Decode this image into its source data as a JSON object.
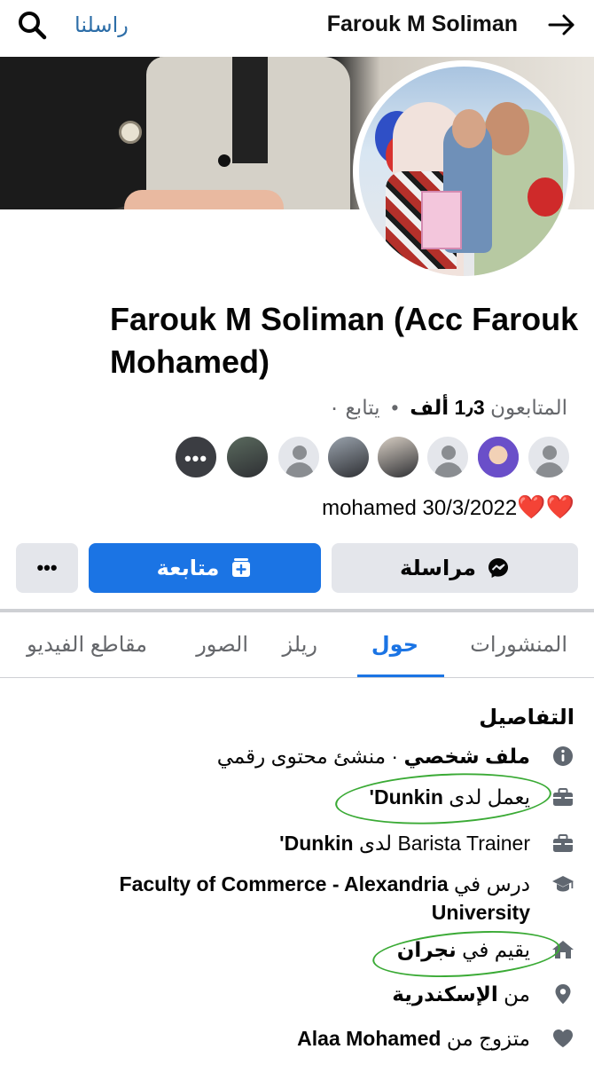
{
  "topbar": {
    "search_icon": "search-icon",
    "message_link": "راسلنا",
    "title": "Farouk M Soliman",
    "back_icon": "arrow-right-icon"
  },
  "profile": {
    "name": "Farouk M Soliman (Acc Farouk Mohamed)",
    "followers_label": "المتابعون",
    "followers_count": "1٫3 ألف",
    "following_label": "يتابع ٠",
    "bio_text": "mohamed 30/3/2022",
    "bio_hearts": "❤️❤️"
  },
  "follower_avatars": [
    {
      "kind": "more",
      "label": "•••"
    },
    {
      "kind": "photo"
    },
    {
      "kind": "default"
    },
    {
      "kind": "photo"
    },
    {
      "kind": "photo"
    },
    {
      "kind": "default"
    },
    {
      "kind": "photo"
    },
    {
      "kind": "default"
    }
  ],
  "actions": {
    "message_label": "مراسلة",
    "follow_label": "متابعة",
    "more_label": "•••"
  },
  "tabs": [
    {
      "label": "المنشورات",
      "active": false
    },
    {
      "label": "حول",
      "active": true
    },
    {
      "label": "ريلز",
      "active": false
    },
    {
      "label": "الصور",
      "active": false
    },
    {
      "label": "مقاطع الفيديو",
      "active": false
    }
  ],
  "details": {
    "title": "التفاصيل",
    "rows": [
      {
        "icon": "info-icon",
        "bold": "ملف شخصي",
        "text": " · منشئ محتوى رقمي"
      },
      {
        "icon": "briefcase-icon",
        "text": "يعمل لدى ",
        "bold": "Dunkin'"
      },
      {
        "icon": "briefcase-icon",
        "text": "Barista Trainer لدى ",
        "bold": "Dunkin'"
      },
      {
        "icon": "graduation-cap-icon",
        "text": "درس في ",
        "bold": "Faculty of Commerce - Alexandria University"
      },
      {
        "icon": "home-icon",
        "text": "يقيم في ",
        "bold": "نجران"
      },
      {
        "icon": "location-pin-icon",
        "text": "من ",
        "bold": "الإسكندرية"
      },
      {
        "icon": "heart-icon",
        "text": "متزوج من ",
        "bold": "Alaa Mohamed"
      }
    ]
  },
  "colors": {
    "accent": "#1b74e4",
    "annotation_green": "#3aaa35",
    "secondary_text": "#65676b"
  }
}
